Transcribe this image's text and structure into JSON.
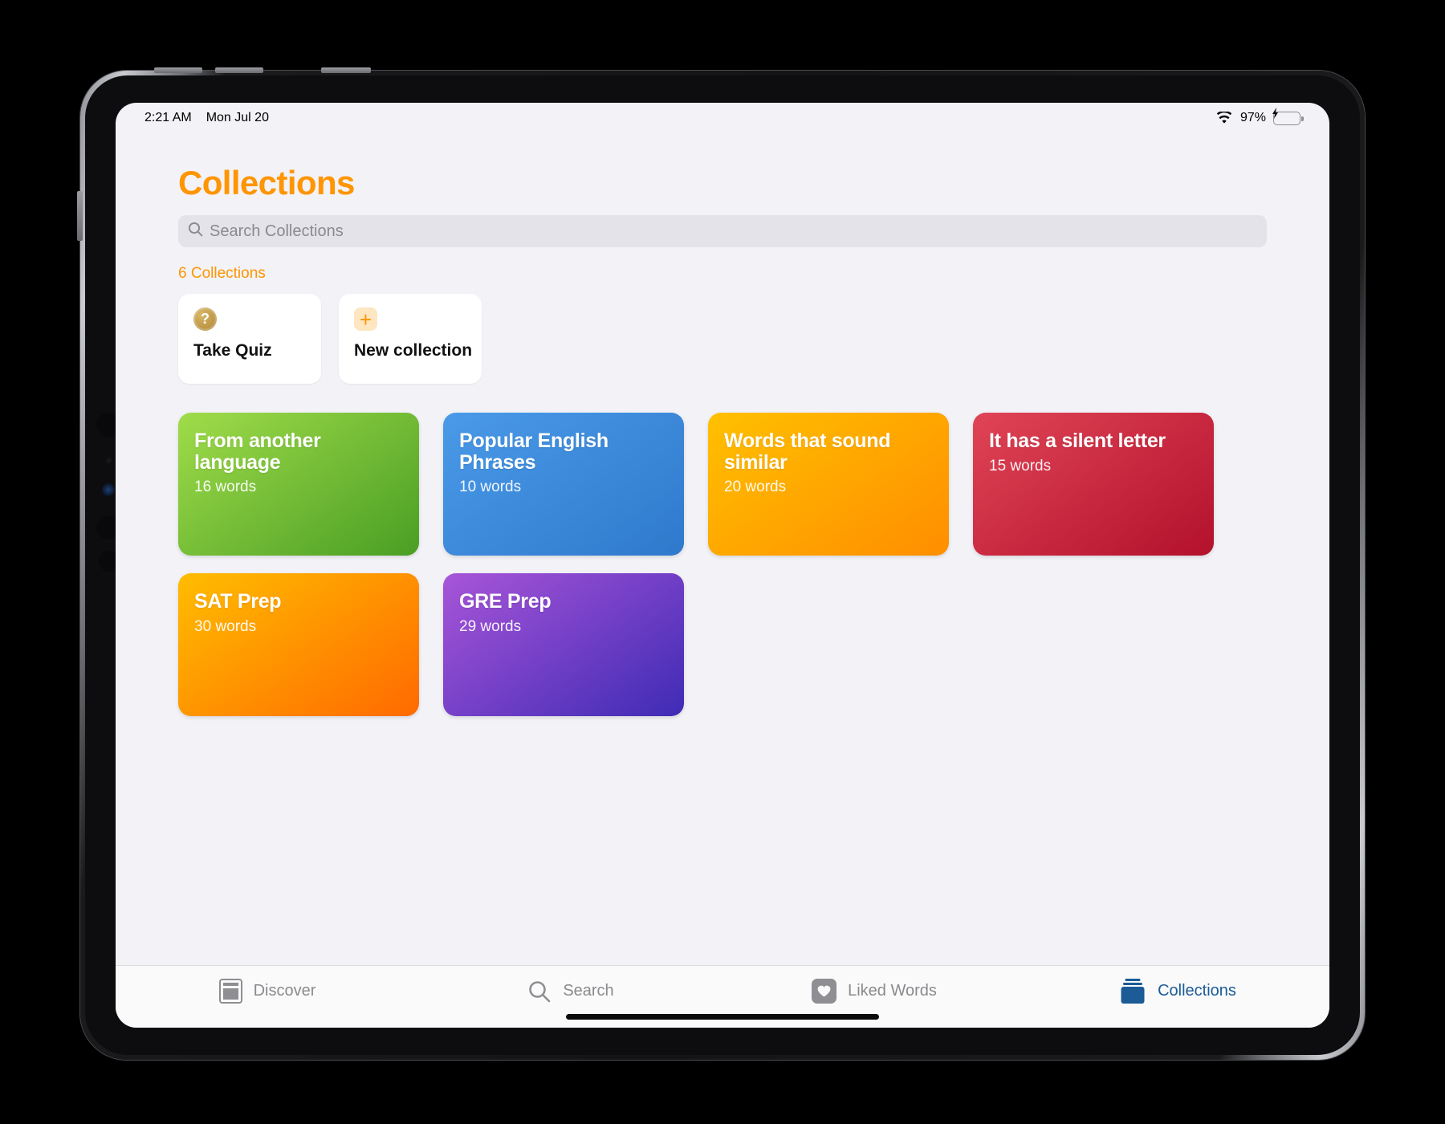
{
  "status_bar": {
    "time": "2:21 AM",
    "date": "Mon Jul 20",
    "wifi_icon": "wifi-icon",
    "battery_percent": "97%",
    "battery_state": "charging",
    "battery_color": "#34c759"
  },
  "header": {
    "title": "Collections",
    "title_color": "#ff9500"
  },
  "search": {
    "placeholder": "Search Collections",
    "value": "",
    "icon": "search-icon"
  },
  "count_label": "6 Collections",
  "actions": [
    {
      "label": "Take Quiz",
      "icon": "question-mark-circle-icon",
      "icon_color": "#c19a49"
    },
    {
      "label": "New collection",
      "icon": "plus-icon",
      "icon_color": "#ff9500"
    }
  ],
  "collections": [
    {
      "title": "From another language",
      "words": "16 words",
      "gradient_from": "#a0dc4a",
      "gradient_to": "#4a9e24"
    },
    {
      "title": "Popular English Phrases",
      "words": "10 words",
      "gradient_from": "#4a9ae8",
      "gradient_to": "#2f79cc"
    },
    {
      "title": "Words that sound similar",
      "words": "20 words",
      "gradient_from": "#ffc000",
      "gradient_to": "#ff8e00"
    },
    {
      "title": "It has a silent letter",
      "words": "15 words",
      "gradient_from": "#e04456",
      "gradient_to": "#b3112c"
    },
    {
      "title": "SAT Prep",
      "words": "30 words",
      "gradient_from": "#ffbd00",
      "gradient_to": "#ff6a00"
    },
    {
      "title": "GRE Prep",
      "words": "29 words",
      "gradient_from": "#a855d8",
      "gradient_to": "#3f2bb5"
    }
  ],
  "tabs": [
    {
      "label": "Discover",
      "icon": "book-icon",
      "active": false
    },
    {
      "label": "Search",
      "icon": "search-icon",
      "active": false
    },
    {
      "label": "Liked Words",
      "icon": "heart-icon",
      "active": false
    },
    {
      "label": "Collections",
      "icon": "collections-stack-icon",
      "active": true
    }
  ],
  "tab_active_color": "#1b5b96",
  "tab_inactive_color": "#8a8a8e"
}
